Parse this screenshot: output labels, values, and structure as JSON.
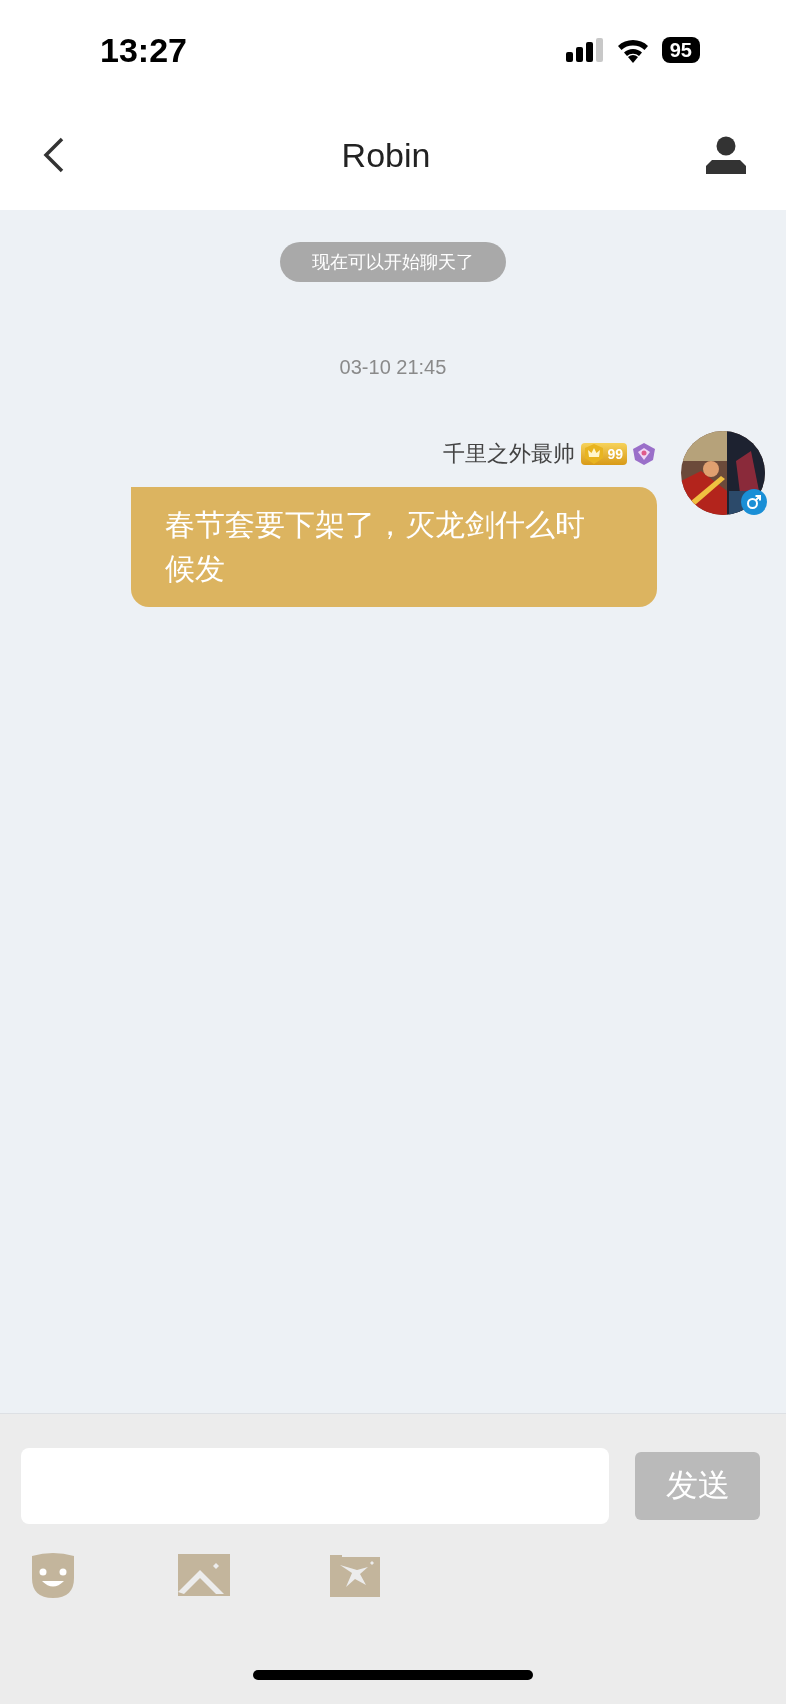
{
  "status_bar": {
    "time": "13:27",
    "battery": "95"
  },
  "header": {
    "title": "Robin"
  },
  "chat": {
    "notice": "现在可以开始聊天了",
    "timestamp": "03-10 21:45",
    "messages": [
      {
        "sender": "千里之外最帅",
        "level_badge": "99",
        "male": true,
        "text": "春节套要下架了，灭龙剑什么时候发"
      }
    ]
  },
  "composer": {
    "send_label": "发送",
    "send_disabled": true
  }
}
